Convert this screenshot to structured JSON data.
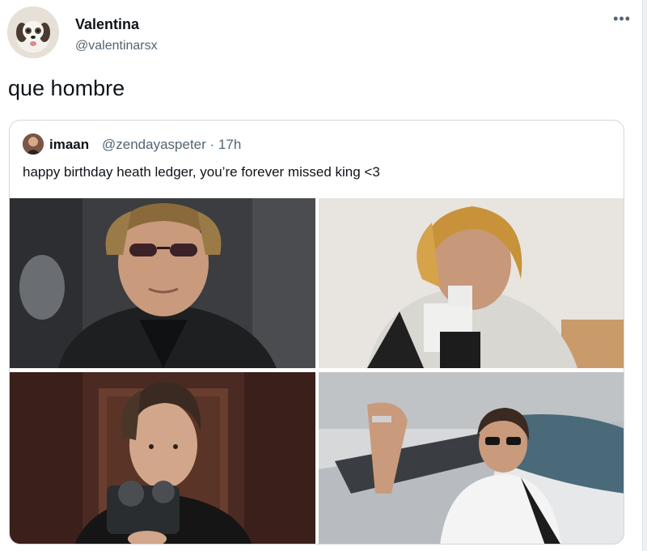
{
  "tweet": {
    "author_name": "Valentina",
    "author_handle": "@valentinarsx",
    "more_label": "•••",
    "text": "que hombre"
  },
  "quoted_tweet": {
    "author_name": "imaan",
    "author_handle": "@zendayaspeter",
    "separator": "·",
    "time": "17h",
    "text": "happy birthday heath ledger, you’re forever missed king <3",
    "photos": [
      {
        "name": "photo-sunglasses-portrait"
      },
      {
        "name": "photo-blonde-with-camera"
      },
      {
        "name": "photo-holding-camera-doorway"
      },
      {
        "name": "photo-airplane-glasses"
      }
    ]
  },
  "colors": {
    "text_primary": "#0f1419",
    "text_secondary": "#536471",
    "border": "#cfd9de"
  }
}
